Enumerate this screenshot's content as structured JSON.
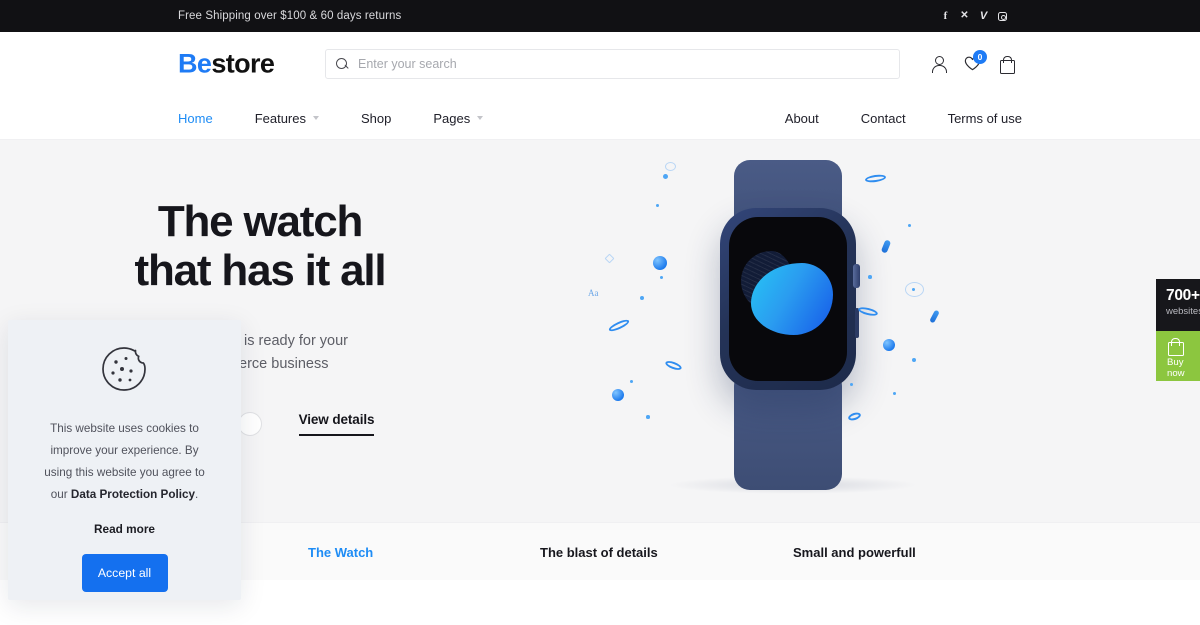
{
  "topbar": {
    "message": "Free Shipping over $100 & 60 days returns",
    "social": [
      {
        "name": "facebook-icon",
        "glyph": "f"
      },
      {
        "name": "x-twitter-icon",
        "glyph": "✕"
      },
      {
        "name": "vimeo-icon",
        "glyph": "V"
      },
      {
        "name": "instagram-icon",
        "glyph": ""
      }
    ]
  },
  "header": {
    "logo_accent": "Be",
    "logo_rest": "store",
    "search_placeholder": "Enter your search",
    "search_value": "",
    "wishlist_count": "0",
    "icons": [
      "account-icon",
      "wishlist-heart-icon",
      "cart-bag-icon"
    ]
  },
  "nav": {
    "left": [
      {
        "label": "Home",
        "active": true,
        "caret": false
      },
      {
        "label": "Features",
        "active": false,
        "caret": true
      },
      {
        "label": "Shop",
        "active": false,
        "caret": false
      },
      {
        "label": "Pages",
        "active": false,
        "caret": true
      }
    ],
    "right": [
      {
        "label": "About"
      },
      {
        "label": "Contact"
      },
      {
        "label": "Terms of use"
      }
    ]
  },
  "hero": {
    "title_line1": "The watch",
    "title_line2": "that has it all",
    "subtitle_line1": "Betheme's is ready for your",
    "subtitle_line2": "ecommerce business",
    "cta": "View details",
    "swatches": [
      {
        "name": "terracotta",
        "hex": "#c87f5d"
      },
      {
        "name": "navy",
        "hex": "#2b3f66"
      },
      {
        "name": "silver",
        "hex": "#c2c4c7"
      },
      {
        "name": "white",
        "hex": "#ffffff"
      }
    ],
    "background": "#f5f5f6",
    "product_image_alt": "navy blue smartwatch with blue gradient blob on screen"
  },
  "tabs": [
    {
      "label": "The Watch",
      "active": true
    },
    {
      "label": "The blast of details",
      "active": false
    },
    {
      "label": "Small and powerfull",
      "active": false
    }
  ],
  "cookie": {
    "text_before": "This website uses cookies to improve your experience. By using this website you agree to our ",
    "policy_link": "Data Protection Policy",
    "text_after": ".",
    "read_more": "Read more",
    "accept_label": "Accept all",
    "button_color": "#1470ef"
  },
  "sticky": {
    "count": "700+",
    "count_sub": "websites",
    "buy_label": "Buy now",
    "buy_color": "#8cc63f"
  }
}
